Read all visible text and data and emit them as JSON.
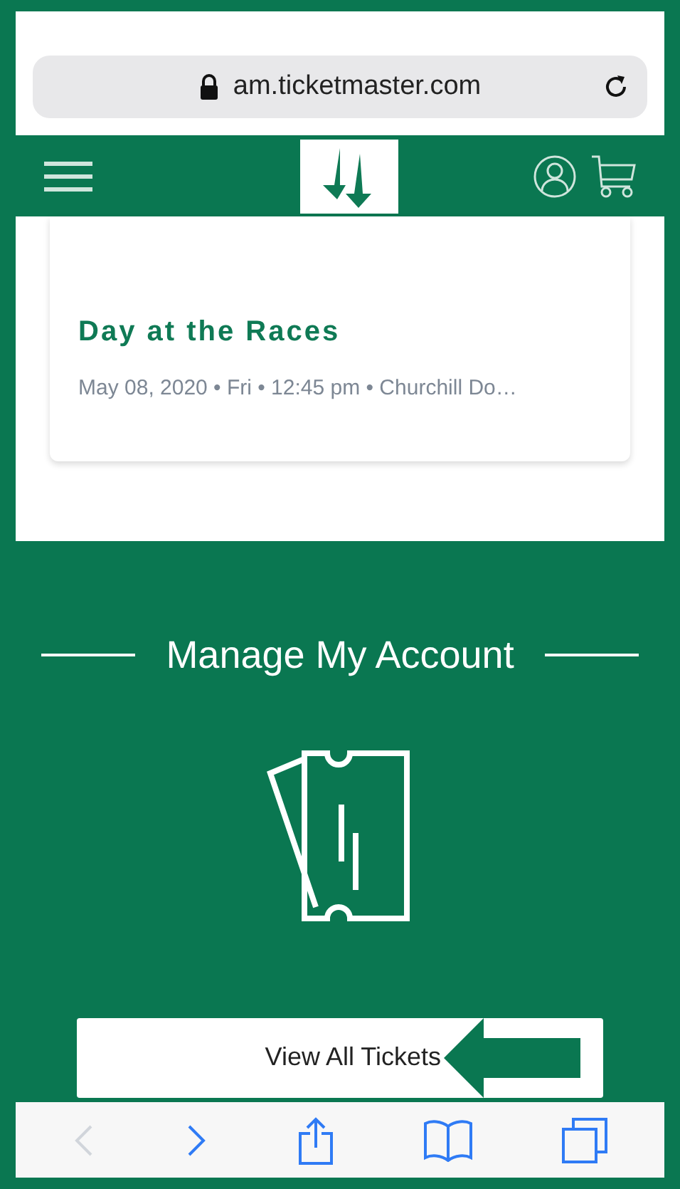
{
  "browser": {
    "url": "am.ticketmaster.com"
  },
  "event": {
    "title": "Day at the Races",
    "details": "May 08, 2020 • Fri • 12:45 pm • Churchill Do…"
  },
  "account": {
    "heading": "Manage My Account",
    "button": "View All Tickets"
  },
  "toolbar": [
    {
      "kind": "back",
      "disabled": true
    },
    {
      "kind": "forward",
      "disabled": false
    },
    {
      "kind": "share",
      "disabled": false
    },
    {
      "kind": "bookmarks",
      "disabled": false
    },
    {
      "kind": "tabs",
      "disabled": false
    }
  ]
}
